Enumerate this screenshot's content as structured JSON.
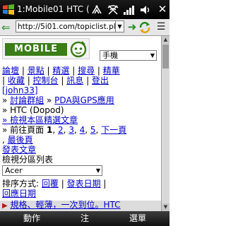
{
  "window": {
    "title": "1:Mobile01 HTC (I"
  },
  "addressbar": {
    "url": "http://5i01.com/topiclist.pl"
  },
  "header": {
    "logo_text": "MOBILE",
    "category_select": "手機"
  },
  "nav": {
    "items": [
      "論壇",
      "景點",
      "精選",
      "搜尋",
      "精華",
      "收藏",
      "控制台",
      "訊息",
      "登出"
    ],
    "user": "[john33]"
  },
  "breadcrumb": {
    "root": "討論群組",
    "sep": "»",
    "group": "PDA與GPS應用",
    "forum": "» HTC (Dopod)"
  },
  "links": {
    "featured": "» 檢視本區精選文章",
    "pages_prefix": "» 前往頁面",
    "pages": [
      "1",
      "2",
      "3",
      "4",
      "5"
    ],
    "next": "下一頁",
    "last": "最後頁",
    "post": "發表文章",
    "view_list": "檢視分區列表"
  },
  "filter": {
    "forum_select": "Acer",
    "sort_label": "排序方式:",
    "sort_reply": "回覆",
    "sort_date": "發表日期",
    "sort_reply_date": "回應日期"
  },
  "topic": {
    "first_title": "規格、輕薄，一次到位。HTC"
  },
  "softkeys": {
    "left": "動作",
    "middle": "注",
    "right": "選單"
  }
}
